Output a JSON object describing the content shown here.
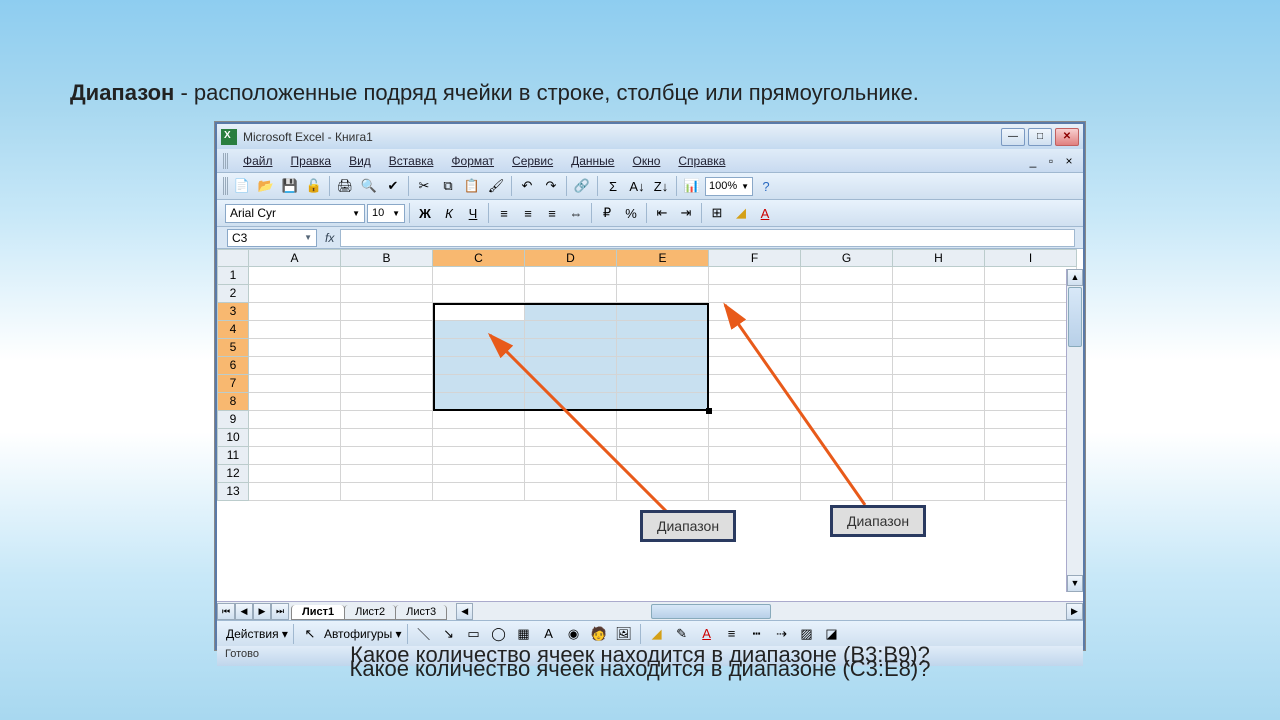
{
  "header": {
    "bold": "Диапазон",
    "rest": " - расположенные подряд ячейки в строке, столбце или прямоугольнике."
  },
  "window": {
    "title": "Microsoft Excel - Книга1"
  },
  "menu": [
    "Файл",
    "Правка",
    "Вид",
    "Вставка",
    "Формат",
    "Сервис",
    "Данные",
    "Окно",
    "Справка"
  ],
  "toolbar": {
    "zoom": "100%"
  },
  "format": {
    "font": "Arial Cyr",
    "size": "10"
  },
  "namebox": "C3",
  "columns": [
    "A",
    "B",
    "C",
    "D",
    "E",
    "F",
    "G",
    "H",
    "I"
  ],
  "selected_cols": [
    "C",
    "D",
    "E"
  ],
  "rows": [
    "1",
    "2",
    "3",
    "4",
    "5",
    "6",
    "7",
    "8",
    "9",
    "10",
    "11",
    "12",
    "13"
  ],
  "selected_rows": [
    "3",
    "4",
    "5",
    "6",
    "7",
    "8"
  ],
  "tabs": [
    "Лист1",
    "Лист2",
    "Лист3"
  ],
  "drawbar": {
    "actions": "Действия",
    "autoshapes": "Автофигуры"
  },
  "status": "Готово",
  "callouts": {
    "left": "Диапазон",
    "right": "Диапазон"
  },
  "question": {
    "line1": "Какое количество ячеек находится в диапазоне (B3:B9)?",
    "line2": "Какое количество ячеек находится в диапазоне (C3:E8)?"
  }
}
